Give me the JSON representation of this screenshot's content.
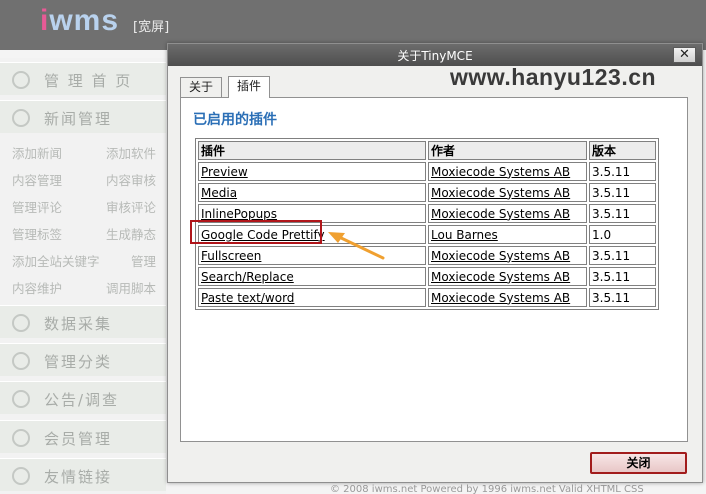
{
  "header": {
    "logo_prefix": "i",
    "logo_rest": "wms",
    "wide_label": "[宽屏]"
  },
  "sidebar": {
    "sections": [
      {
        "label": "管 理 首 页",
        "icon": "home-icon"
      },
      {
        "label": "新闻管理",
        "icon": "news-icon"
      },
      {
        "label": "数据采集",
        "icon": "globe-icon"
      },
      {
        "label": "管理分类",
        "icon": "category-icon"
      },
      {
        "label": "公告/调查",
        "icon": "chat-icon"
      },
      {
        "label": "会员管理",
        "icon": "users-icon"
      },
      {
        "label": "友情链接",
        "icon": "heart-icon"
      }
    ],
    "news_items": [
      [
        "添加新闻",
        "添加软件"
      ],
      [
        "内容管理",
        "内容审核"
      ],
      [
        "管理评论",
        "审核评论"
      ],
      [
        "管理标签",
        "生成静态"
      ],
      [
        "添加全站关键字",
        "管理"
      ],
      [
        "内容维护",
        "调用脚本"
      ]
    ]
  },
  "footer_fragment": "© 2008 iwms.net  Powered by 1996 iwms.net  Valid XHTML CSS",
  "watermark": "www.hanyu123.cn",
  "dialog": {
    "title": "关于TinyMCE",
    "close_x": "✕",
    "tabs": [
      {
        "label": "关于"
      },
      {
        "label": "插件"
      }
    ],
    "panel_title": "已启用的插件",
    "columns": [
      "插件",
      "作者",
      "版本"
    ],
    "rows": [
      {
        "plugin": "Preview",
        "author": "Moxiecode Systems AB",
        "version": "3.5.11"
      },
      {
        "plugin": "Media",
        "author": "Moxiecode Systems AB",
        "version": "3.5.11"
      },
      {
        "plugin": "InlinePopups",
        "author": "Moxiecode Systems AB",
        "version": "3.5.11"
      },
      {
        "plugin": "Google Code Prettify",
        "author": "Lou Barnes",
        "version": "1.0"
      },
      {
        "plugin": "Fullscreen",
        "author": "Moxiecode Systems AB",
        "version": "3.5.11"
      },
      {
        "plugin": "Search/Replace",
        "author": "Moxiecode Systems AB",
        "version": "3.5.11"
      },
      {
        "plugin": "Paste text/word",
        "author": "Moxiecode Systems AB",
        "version": "3.5.11"
      }
    ],
    "close_button": "关闭"
  },
  "colors": {
    "accent_blue": "#2b6fb6",
    "highlight_red": "#b0151a",
    "arrow_orange": "#f0a030"
  }
}
